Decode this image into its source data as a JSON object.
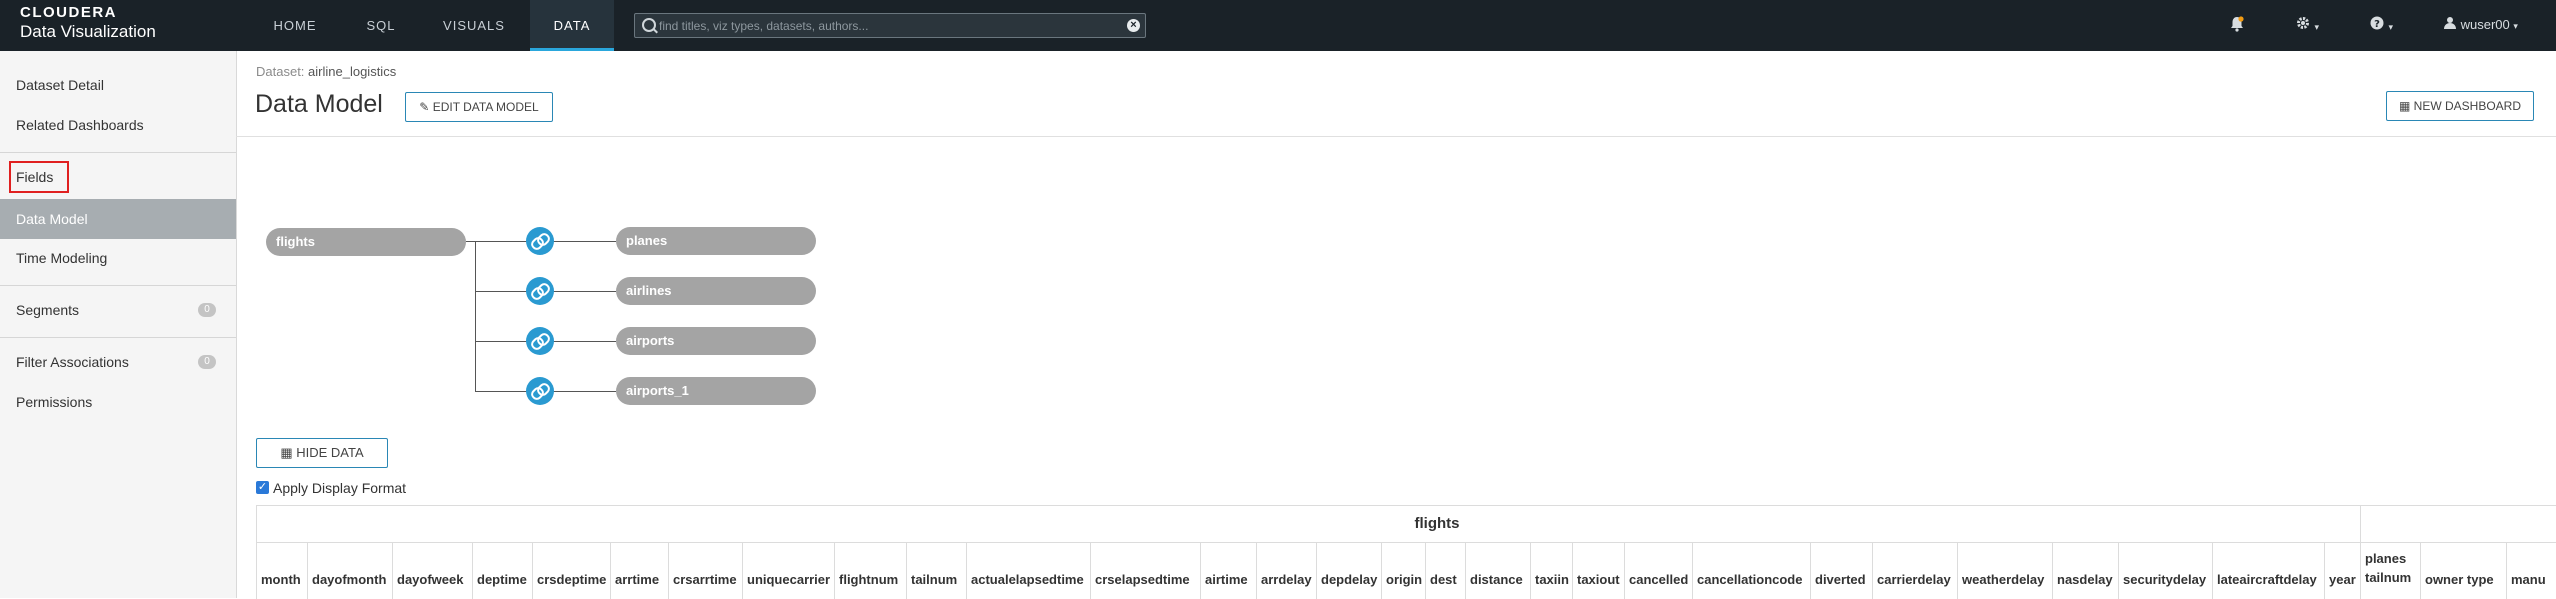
{
  "brand": {
    "company": "CLOUDERA",
    "product": "Data Visualization"
  },
  "nav": [
    {
      "label": "HOME",
      "active": false
    },
    {
      "label": "SQL",
      "active": false
    },
    {
      "label": "VISUALS",
      "active": false
    },
    {
      "label": "DATA",
      "active": true
    }
  ],
  "search": {
    "placeholder": "find titles, viz types, datasets, authors...",
    "value": ""
  },
  "header_icons": [
    "bell-icon",
    "gear-icon",
    "help-icon",
    "user-icon"
  ],
  "user": {
    "name": "wuser00"
  },
  "sidebar": {
    "items": [
      {
        "label": "Dataset Detail"
      },
      {
        "label": "Related Dashboards"
      },
      {
        "label": "Fields"
      },
      {
        "label": "Data Model",
        "active": true
      },
      {
        "label": "Time Modeling"
      },
      {
        "label": "Segments",
        "badge": "0"
      },
      {
        "label": "Filter Associations",
        "badge": "0"
      },
      {
        "label": "Permissions"
      }
    ]
  },
  "breadcrumb": {
    "prefix": "Dataset:",
    "dataset": "airline_logistics"
  },
  "page_title": "Data Model",
  "buttons": {
    "edit_model": "EDIT DATA MODEL",
    "new_dashboard": "NEW DASHBOARD",
    "hide_data": "HIDE DATA"
  },
  "model": {
    "root": "flights",
    "joins": [
      "planes",
      "airlines",
      "airports",
      "airports_1"
    ]
  },
  "apply_display_format": {
    "label": "Apply Display Format",
    "checked": true
  },
  "table": {
    "group": "flights",
    "columns": [
      "month",
      "dayofmonth",
      "dayofweek",
      "deptime",
      "crsdeptime",
      "arrtime",
      "crsarrtime",
      "uniquecarrier",
      "flightnum",
      "tailnum",
      "actualelapsedtime",
      "crselapsedtime",
      "airtime",
      "arrdelay",
      "depdelay",
      "origin",
      "dest",
      "distance",
      "taxiin",
      "taxiout",
      "cancelled",
      "cancellationcode",
      "diverted",
      "carrierdelay",
      "weatherdelay",
      "nasdelay",
      "securitydelay",
      "lateaircraftdelay",
      "year",
      "planes tailnum",
      "owner type",
      "manu"
    ]
  },
  "colors": {
    "topbar": "#1a2228",
    "accent": "#2a9ad1",
    "pill": "#a4a4a4",
    "highlight_box": "#e02020"
  }
}
